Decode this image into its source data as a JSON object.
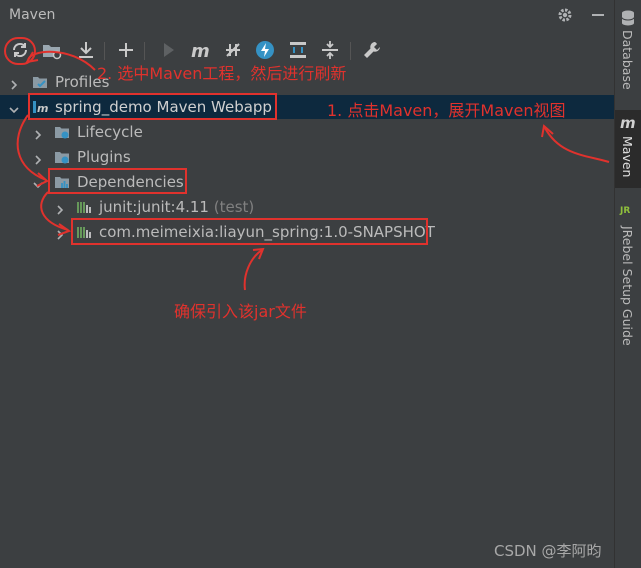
{
  "window": {
    "title": "Maven"
  },
  "tree": {
    "items": [
      {
        "label": "Profiles"
      },
      {
        "label": "spring_demo Maven Webapp"
      },
      {
        "label": "Lifecycle"
      },
      {
        "label": "Plugins"
      },
      {
        "label": "Dependencies"
      },
      {
        "label": "junit:junit:4.11",
        "suffix": "(test)"
      },
      {
        "label": "com.meimeixia:liayun_spring:1.0-SNAPSHOT"
      }
    ]
  },
  "right_sidebar": {
    "tabs": [
      {
        "label": "Database"
      },
      {
        "label": "Maven",
        "icon": "m"
      },
      {
        "label": "JRebel Setup Guide",
        "icon": "JR"
      }
    ]
  },
  "annotations": {
    "step1": "1. 点击Maven，展开Maven视图",
    "step2": "2. 选中Maven工程，然后进行刷新",
    "note": "确保引入该jar文件"
  },
  "watermark": "CSDN @李阿昀",
  "colors": {
    "background": "#3c3f41",
    "selection": "#0d293e",
    "annotation": "#e0322d",
    "text": "#bbbbbb",
    "icon_blue": "#3592c4"
  }
}
